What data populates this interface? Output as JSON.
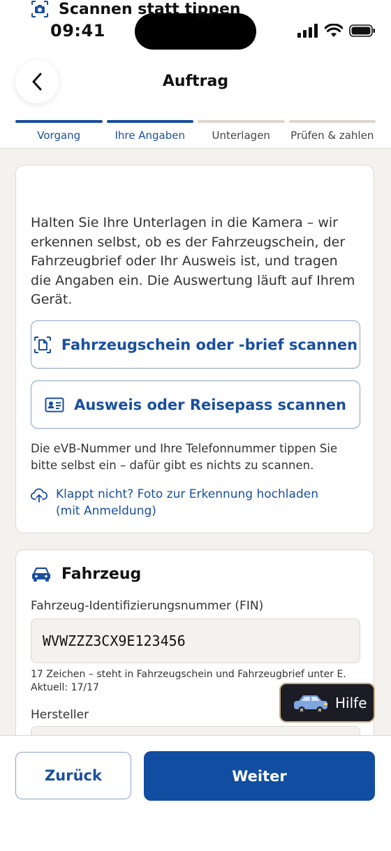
{
  "status_bar": {
    "time": "09:41"
  },
  "header": {
    "title": "Auftrag"
  },
  "steps": [
    {
      "label": "Vorgang",
      "done": true
    },
    {
      "label": "Ihre Angaben",
      "done": true
    },
    {
      "label": "Unterlagen",
      "done": false
    },
    {
      "label": "Prüfen & zahlen",
      "done": false
    }
  ],
  "scan_card": {
    "title": "Scannen statt tippen",
    "intro": "Halten Sie Ihre Unterlagen in die Kamera – wir erkennen selbst, ob es der Fahrzeugschein, der Fahrzeugbrief oder Ihr Ausweis ist, und tragen die Angaben ein. Die Auswertung läuft auf Ihrem Gerät.",
    "scan_vehicle_label": "Fahrzeugschein oder -brief scannen",
    "scan_id_label": "Ausweis oder Reisepass scannen",
    "hint": "Die eVB-Nummer und Ihre Telefonnummer tippen Sie bitte selbst ein – dafür gibt es nichts zu scannen.",
    "upload_link": "Klappt nicht? Foto zur Erkennung hochladen (mit Anmeldung)"
  },
  "vehicle_card": {
    "title": "Fahrzeug",
    "fin_label": "Fahrzeug-Identifizierungsnummer (FIN)",
    "fin_value": "WVWZZZ3CX9E123456",
    "fin_hint": "17 Zeichen – steht in Fahrzeugschein und Fahrzeugbrief unter E.",
    "fin_count": "Aktuell: 17/17",
    "manufacturer_label": "Hersteller"
  },
  "help": {
    "label": "Hilfe"
  },
  "footer": {
    "back_label": "Zurück",
    "next_label": "Weiter"
  },
  "colors": {
    "accent": "#114da0",
    "link": "#1a4f9c",
    "background": "#f4f2ee"
  }
}
